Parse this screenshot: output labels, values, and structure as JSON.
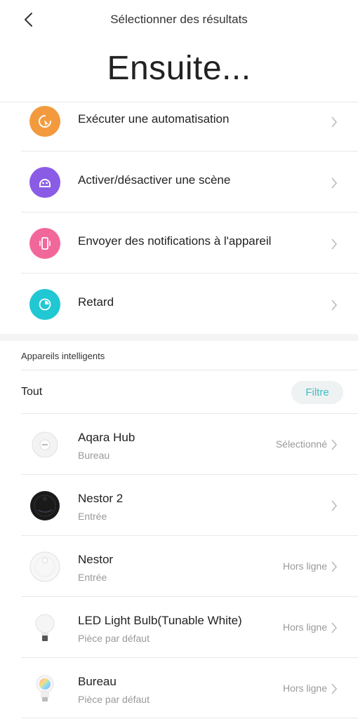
{
  "header": {
    "back_icon": "chevron-left-icon",
    "title": "Sélectionner des résultats",
    "subtitle": "Ensuite..."
  },
  "actions": [
    {
      "label": "Exécuter une automatisation",
      "icon": "automation-icon",
      "color": "#f39a3f"
    },
    {
      "label": "Activer/désactiver une scène",
      "icon": "scene-icon",
      "color": "#8a5ce6"
    },
    {
      "label": "Envoyer des notifications à l'appareil",
      "icon": "phone-vibrate-icon",
      "color": "#f2679a"
    },
    {
      "label": "Retard",
      "icon": "timer-icon",
      "color": "#1fc8d3"
    }
  ],
  "devices_section": {
    "title": "Appareils intelligents",
    "filter_all": "Tout",
    "filter_button": "Filtre",
    "accent": "#3cbdc5"
  },
  "devices": [
    {
      "name": "Aqara Hub",
      "room": "Bureau",
      "status": "Sélectionné",
      "icon": "hub-icon"
    },
    {
      "name": "Nestor 2",
      "room": "Entrée",
      "status": "",
      "icon": "robot-vacuum-black-icon"
    },
    {
      "name": "Nestor",
      "room": "Entrée",
      "status": "Hors ligne",
      "icon": "robot-vacuum-white-icon"
    },
    {
      "name": "LED Light Bulb(Tunable White)",
      "room": "Pièce par défaut",
      "status": "Hors ligne",
      "icon": "light-bulb-icon"
    },
    {
      "name": "Bureau",
      "room": "Pièce par défaut",
      "status": "Hors ligne",
      "icon": "color-bulb-icon"
    }
  ]
}
